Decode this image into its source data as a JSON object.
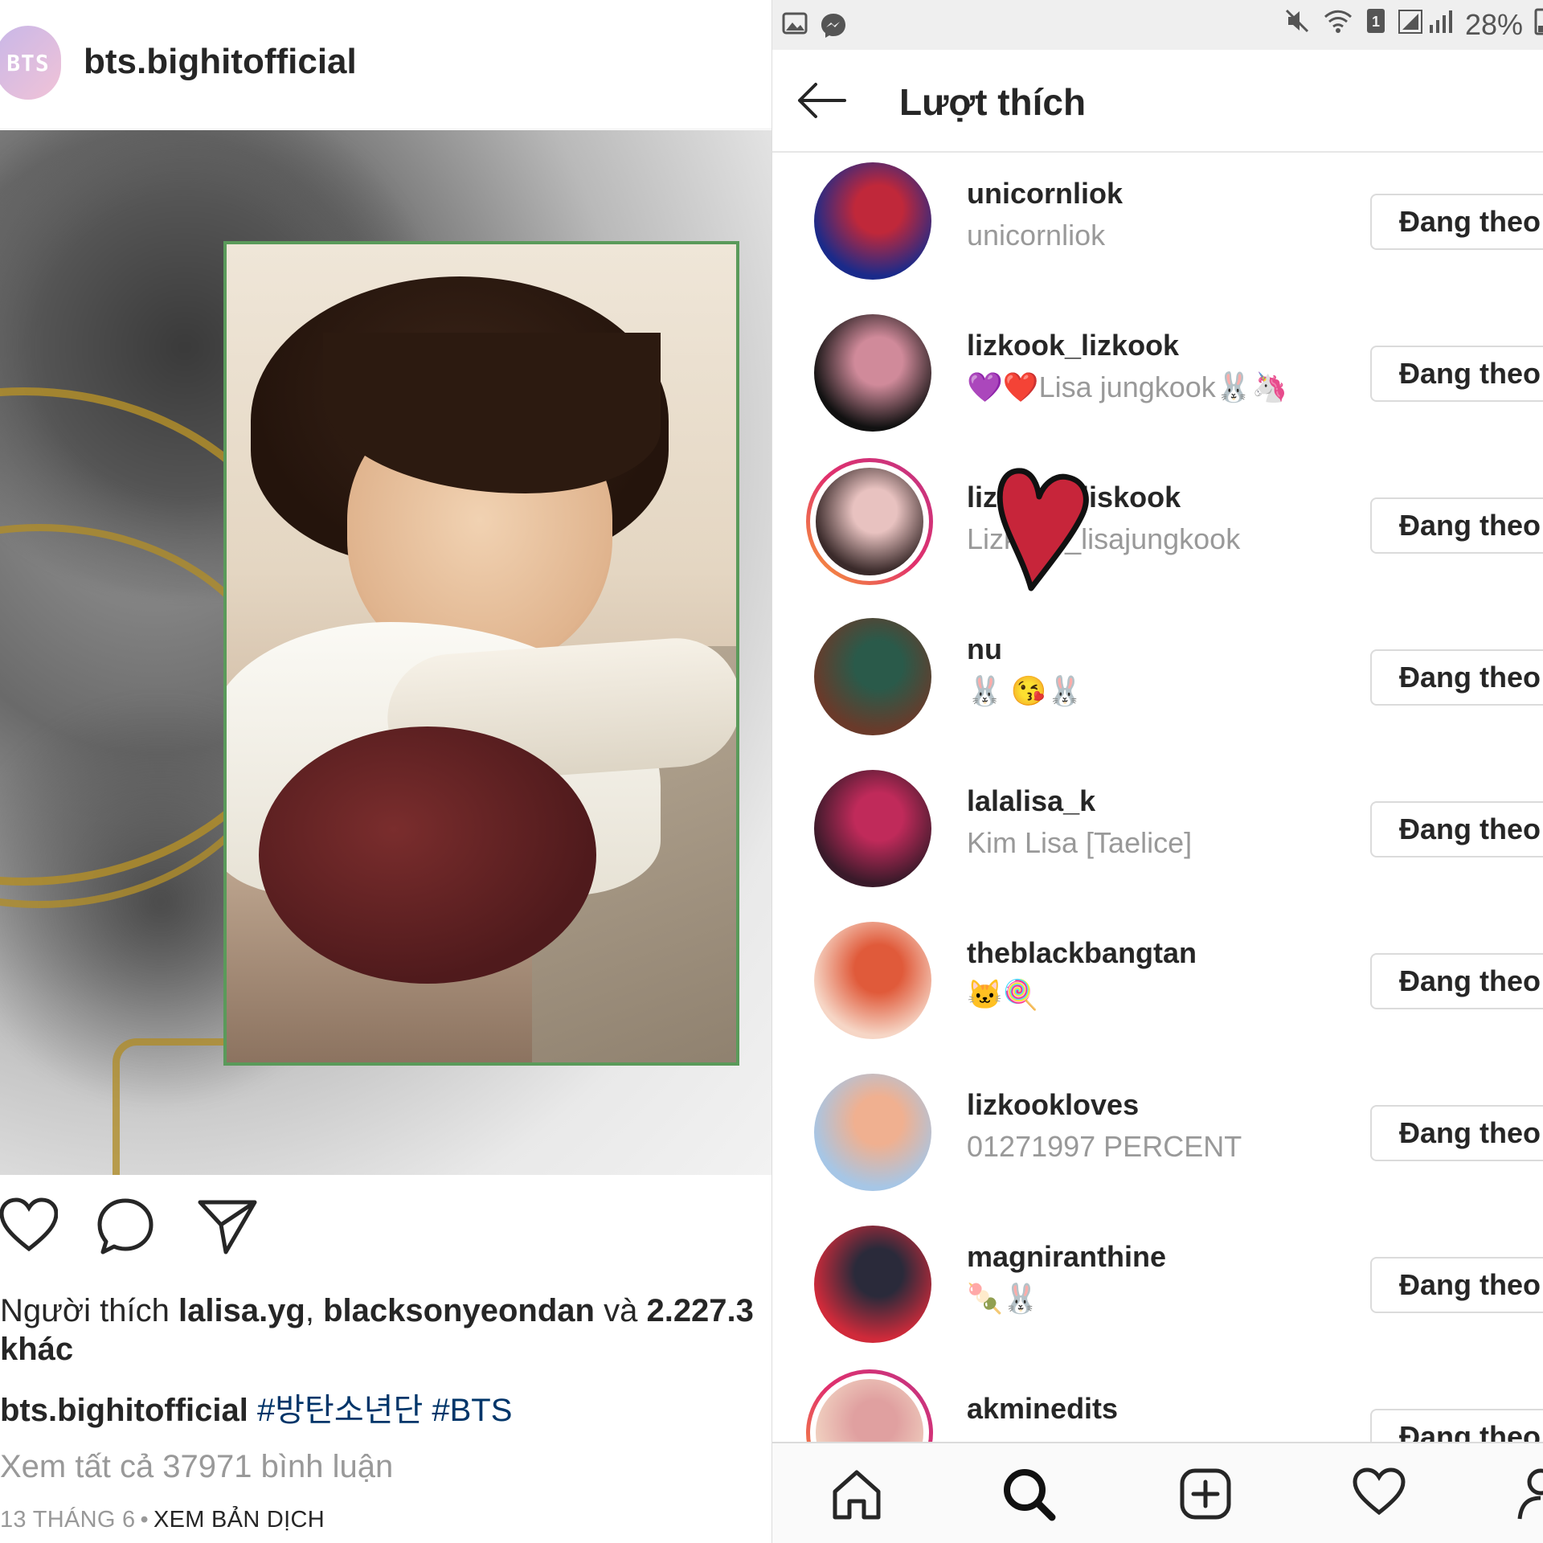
{
  "post": {
    "username": "bts.bighitofficial",
    "avatar_text": "BTS",
    "likes_prefix": "Người thích ",
    "likes_user1": "lalisa.yg",
    "likes_comma": ", ",
    "likes_user2": "blacksonyeondan",
    "likes_and": " và ",
    "likes_count": "2.227.3",
    "likes_suffix": "khác",
    "caption_user": "bts.bighitofficial",
    "caption_tags": "#방탄소년단 #BTS",
    "view_comments": "Xem tất cả 37971 bình luận",
    "date": "13 THÁNG 6",
    "date_sep": "•",
    "translate": "XEM BẢN DỊCH",
    "icons": [
      "heart-icon",
      "comment-icon",
      "share-icon"
    ]
  },
  "status_bar": {
    "battery_percent": "28%",
    "icons": [
      "gallery-icon",
      "messenger-icon",
      "mute-icon",
      "wifi-icon",
      "sim-icon",
      "signal-icon",
      "battery-icon"
    ]
  },
  "likes_screen": {
    "title": "Lượt thích",
    "follow_label": "Đang theo",
    "users": [
      {
        "username": "unicornliok",
        "fullname": "unicornliok",
        "colors": [
          "#1a2a8a",
          "#c0283a"
        ]
      },
      {
        "username": "lizkook_lizkook",
        "fullname": "💜❤️Lisa jungkook🐰🦄",
        "colors": [
          "#111111",
          "#d08a9a"
        ]
      },
      {
        "username": "lizkook_liskook",
        "fullname": "Lizkook_lisajungkook",
        "colors": [
          "#3a2a2a",
          "#e8c2c0"
        ],
        "ring": true
      },
      {
        "username": "nu",
        "fullname": "🐰 😘🐰",
        "colors": [
          "#6a3a2a",
          "#2a5a4a"
        ]
      },
      {
        "username": "lalalisa_k",
        "fullname": "Kim Lisa [Taelice]",
        "colors": [
          "#3a1a2a",
          "#c02a5a"
        ]
      },
      {
        "username": "theblackbangtan",
        "fullname": "🐱🍭",
        "colors": [
          "#f6d6c6",
          "#e05a3a"
        ]
      },
      {
        "username": "lizkookloves",
        "fullname": "01271997 PERCENT",
        "colors": [
          "#a6c6e6",
          "#f0b090"
        ]
      },
      {
        "username": "magniranthine",
        "fullname": "🍡🐰",
        "colors": [
          "#d02a3a",
          "#2a2a3a"
        ]
      },
      {
        "username": "akminedits",
        "fullname": "",
        "colors": [
          "#f0d0c0",
          "#e0a0a0"
        ],
        "ring": true
      }
    ]
  },
  "bottom_nav": {
    "icons": [
      "home-icon",
      "search-icon",
      "add-icon",
      "activity-heart-icon",
      "profile-icon"
    ]
  }
}
